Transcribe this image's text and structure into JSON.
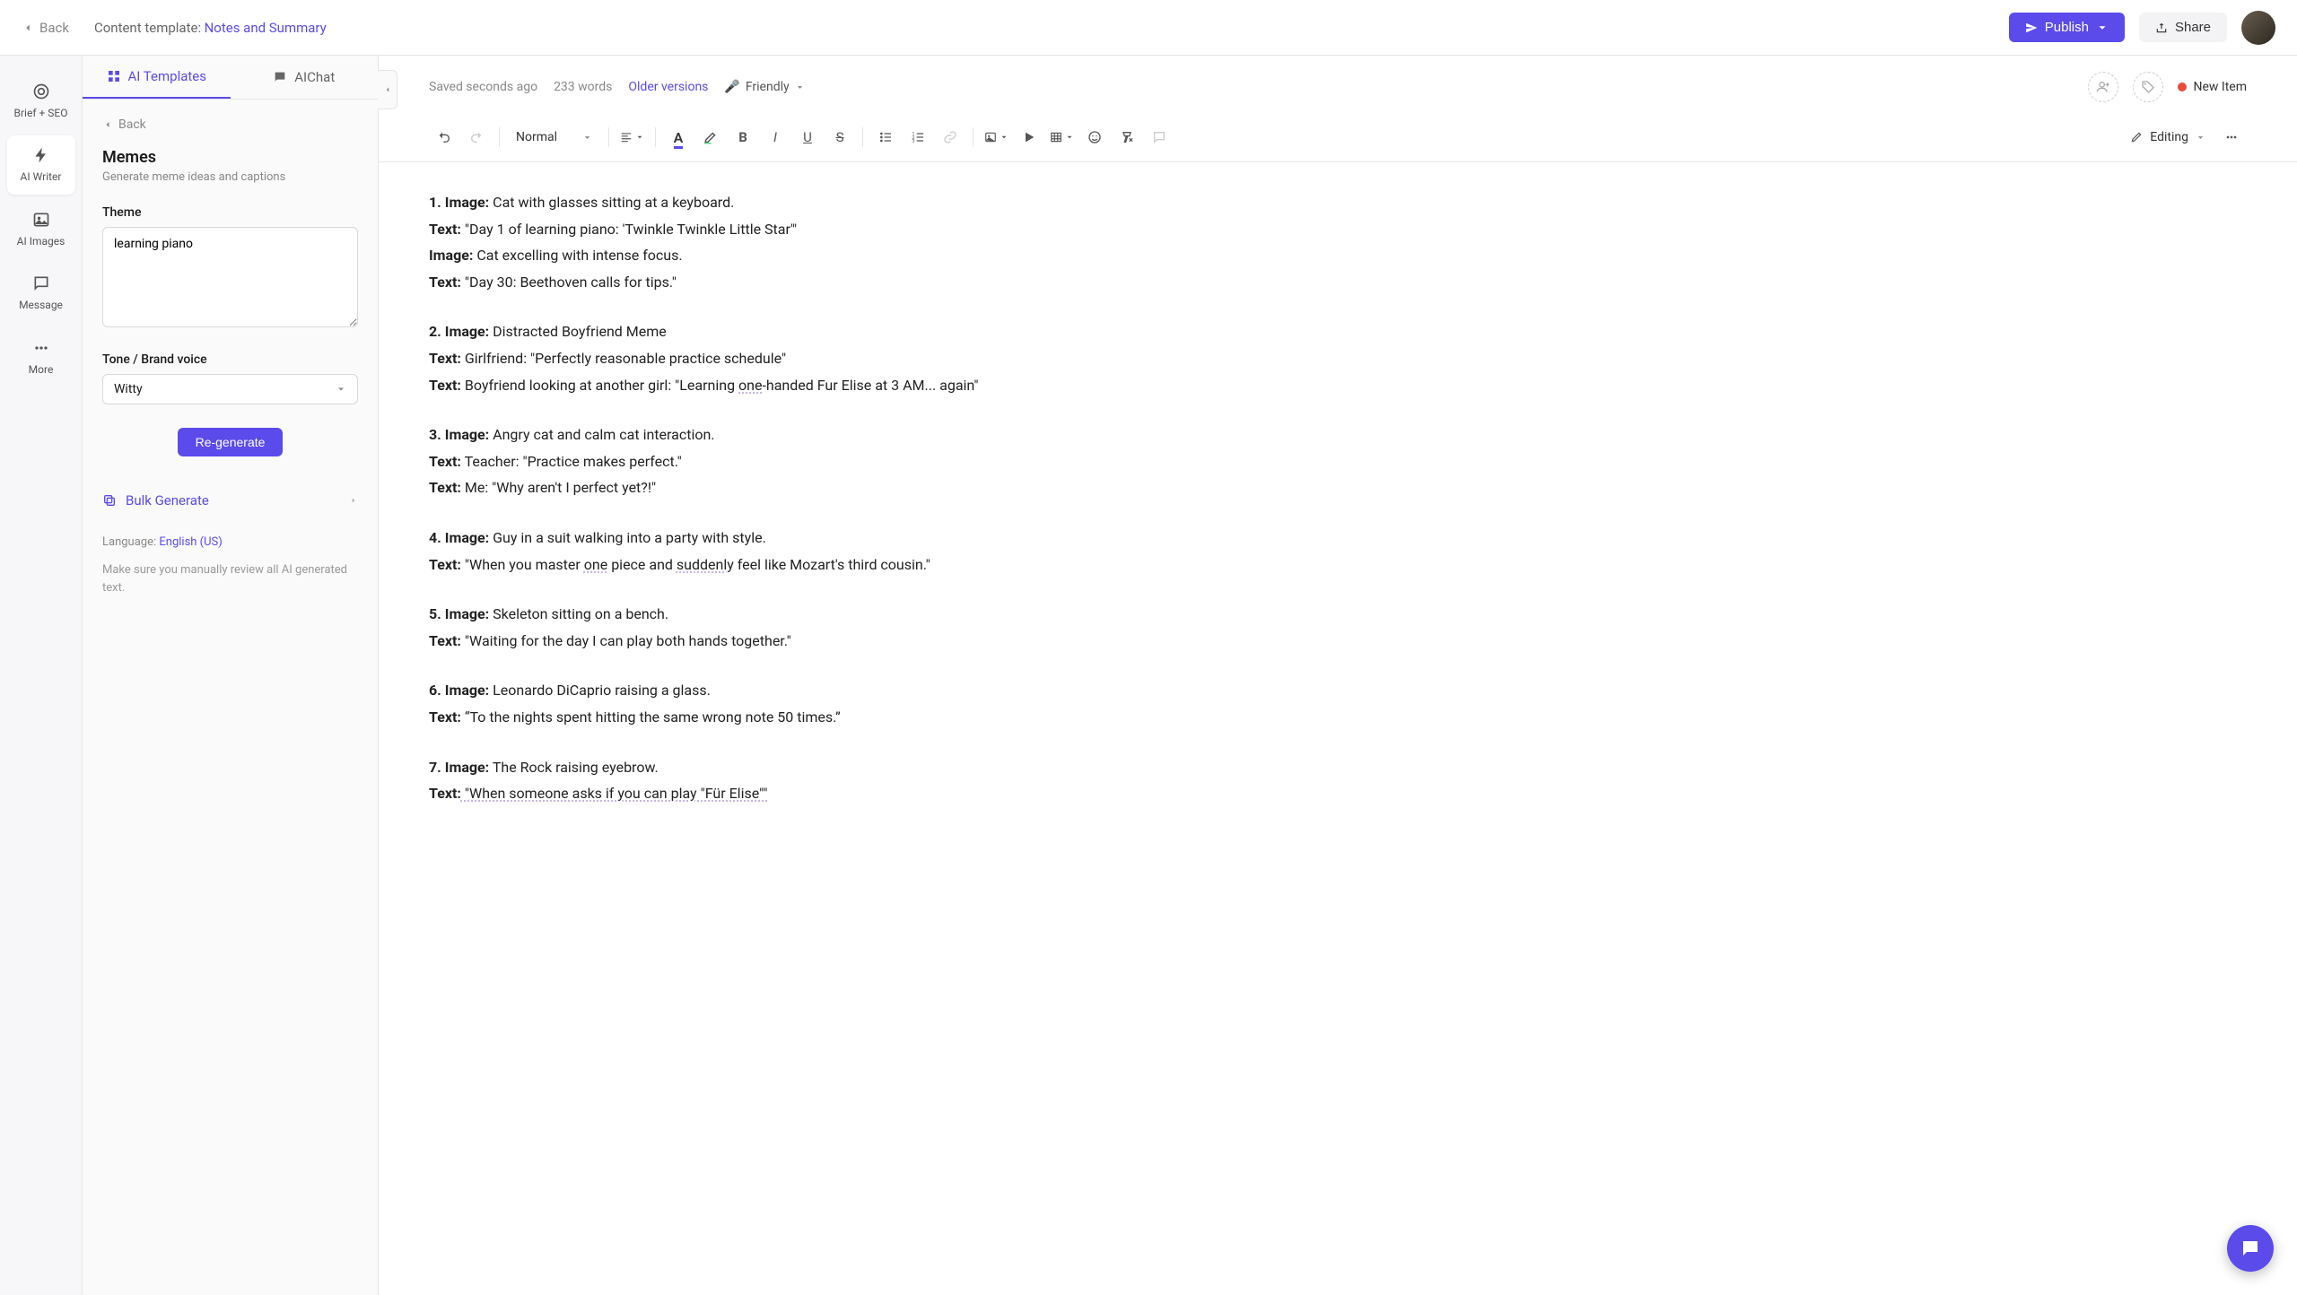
{
  "header": {
    "back": "Back",
    "template_prefix": "Content template:",
    "template_name": "Notes and Summary",
    "publish": "Publish",
    "share": "Share"
  },
  "rail": {
    "brief": "Brief + SEO",
    "writer": "AI Writer",
    "images": "AI Images",
    "message": "Message",
    "more": "More"
  },
  "panel": {
    "tab_templates": "AI Templates",
    "tab_chat": "AIChat",
    "back": "Back",
    "title": "Memes",
    "subtitle": "Generate meme ideas and captions",
    "theme_label": "Theme",
    "theme_value": "learning piano",
    "tone_label": "Tone / Brand voice",
    "tone_value": "Witty",
    "regen": "Re-generate",
    "bulk": "Bulk Generate",
    "language_prefix": "Language:",
    "language_value": "English (US)",
    "disclaimer": "Make sure you manually review all AI generated text."
  },
  "infobar": {
    "saved": "Saved seconds ago",
    "words": "233 words",
    "older": "Older versions",
    "friendly": "Friendly",
    "status": "New Item"
  },
  "toolbar": {
    "normal": "Normal",
    "editing": "Editing"
  },
  "doc": {
    "b1l1a": "1. Image:",
    "b1l1b": " Cat with glasses sitting at a keyboard.",
    "b1l2a": "Text:",
    "b1l2b": " \"Day 1 of learning piano: 'Twinkle Twinkle Little Star'\"",
    "b1l3a": "Image:",
    "b1l3b": " Cat excelling with intense focus.",
    "b1l4a": "Text:",
    "b1l4b": " \"Day 30: Beethoven calls for tips.\"",
    "b2l1a": "2. Image:",
    "b2l1b": " Distracted Boyfriend Meme",
    "b2l2a": "Text:",
    "b2l2b": " Girlfriend: \"Perfectly reasonable practice schedule\"",
    "b2l3a": "Text:",
    "b2l3b_pre": " Boyfriend looking at another girl: \"Learning ",
    "b2l3b_wavy": "one",
    "b2l3b_post": "-handed Fur Elise at 3 AM... again\"",
    "b3l1a": "3. Image:",
    "b3l1b": " Angry cat and calm cat interaction.",
    "b3l2a": "Text:",
    "b3l2b": " Teacher: \"Practice makes perfect.\"",
    "b3l3a": "Text:",
    "b3l3b": " Me: \"Why aren't I perfect yet?!\"",
    "b4l1a": "4. Image:",
    "b4l1b": " Guy in a suit walking into a party with style.",
    "b4l2a": "Text:",
    "b4l2b_pre": " \"When you master ",
    "b4l2b_w1": "one",
    "b4l2b_mid": " piece and ",
    "b4l2b_w2": "suddenly",
    "b4l2b_post": " feel like Mozart's third cousin.\"",
    "b5l1a": "5. Image:",
    "b5l1b": " Skeleton sitting on a bench.",
    "b5l2a": "Text:",
    "b5l2b": " \"Waiting for the day I can play both hands together.\"",
    "b6l1a": "6. Image:",
    "b6l1b": " Leonardo DiCaprio raising a glass.",
    "b6l2a": "Text:",
    "b6l2b": " “To the nights spent hitting the same wrong note 50 times.”",
    "b7l1a": "7. Image:",
    "b7l1b": " The Rock raising eyebrow.",
    "b7l2a": "Text:",
    "b7l2b": " \"When someone asks if you can play \"Für Elise\"\""
  }
}
